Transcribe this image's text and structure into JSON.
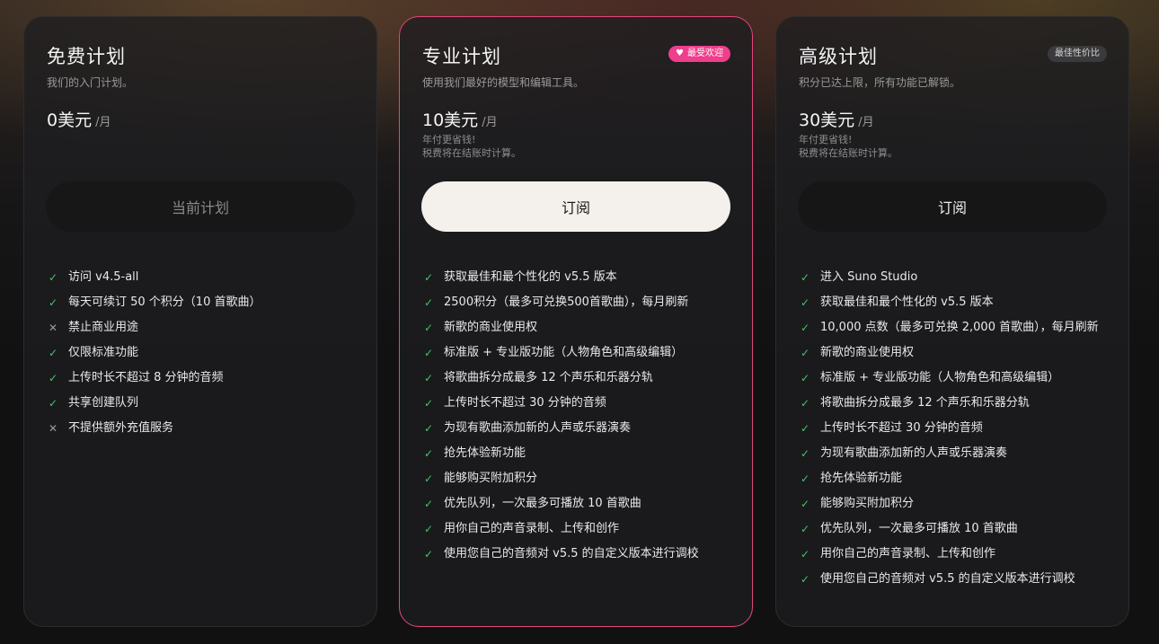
{
  "plans": {
    "free": {
      "name": "免费计划",
      "desc": "我们的入门计划。",
      "price": "0美元",
      "unit": "/月",
      "cta": "当前计划",
      "features": [
        {
          "icon": "check",
          "text": "访问 v4.5-all"
        },
        {
          "icon": "check",
          "text": "每天可续订 50 个积分（10 首歌曲）"
        },
        {
          "icon": "cross",
          "text": "禁止商业用途"
        },
        {
          "icon": "check",
          "text": "仅限标准功能"
        },
        {
          "icon": "check",
          "text": "上传时长不超过 8 分钟的音频"
        },
        {
          "icon": "check",
          "text": "共享创建队列"
        },
        {
          "icon": "cross",
          "text": "不提供额外充值服务"
        }
      ]
    },
    "pro": {
      "name": "专业计划",
      "badge": "最受欢迎",
      "desc": "使用我们最好的模型和编辑工具。",
      "price": "10美元",
      "unit": "/月",
      "note1": "年付更省钱!",
      "note2": "税费将在结账时计算。",
      "cta": "订阅",
      "features": [
        {
          "icon": "check",
          "text": "获取最佳和最个性化的 v5.5 版本"
        },
        {
          "icon": "check",
          "text": "2500积分（最多可兑换500首歌曲），每月刷新"
        },
        {
          "icon": "check",
          "text": "新歌的商业使用权"
        },
        {
          "icon": "check",
          "text": "标准版 + 专业版功能（人物角色和高级编辑）"
        },
        {
          "icon": "check",
          "text": "将歌曲拆分成最多 12 个声乐和乐器分轨"
        },
        {
          "icon": "check",
          "text": "上传时长不超过 30 分钟的音频"
        },
        {
          "icon": "check",
          "text": "为现有歌曲添加新的人声或乐器演奏"
        },
        {
          "icon": "check",
          "text": "抢先体验新功能"
        },
        {
          "icon": "check",
          "text": "能够购买附加积分"
        },
        {
          "icon": "check",
          "text": "优先队列，一次最多可播放 10 首歌曲"
        },
        {
          "icon": "check",
          "text": "用你自己的声音录制、上传和创作"
        },
        {
          "icon": "check",
          "text": "使用您自己的音频对 v5.5 的自定义版本进行调校"
        }
      ]
    },
    "premier": {
      "name": "高级计划",
      "badge": "最佳性价比",
      "desc": "积分已达上限，所有功能已解锁。",
      "price": "30美元",
      "unit": "/月",
      "note1": "年付更省钱!",
      "note2": "税费将在结账时计算。",
      "cta": "订阅",
      "features": [
        {
          "icon": "check",
          "text": "进入 Suno Studio"
        },
        {
          "icon": "check",
          "text": "获取最佳和最个性化的 v5.5 版本"
        },
        {
          "icon": "check",
          "text": "10,000 点数（最多可兑换 2,000 首歌曲），每月刷新"
        },
        {
          "icon": "check",
          "text": "新歌的商业使用权"
        },
        {
          "icon": "check",
          "text": "标准版 + 专业版功能（人物角色和高级编辑）"
        },
        {
          "icon": "check",
          "text": "将歌曲拆分成最多 12 个声乐和乐器分轨"
        },
        {
          "icon": "check",
          "text": "上传时长不超过 30 分钟的音频"
        },
        {
          "icon": "check",
          "text": "为现有歌曲添加新的人声或乐器演奏"
        },
        {
          "icon": "check",
          "text": "抢先体验新功能"
        },
        {
          "icon": "check",
          "text": "能够购买附加积分"
        },
        {
          "icon": "check",
          "text": "优先队列，一次最多可播放 10 首歌曲"
        },
        {
          "icon": "check",
          "text": "用你自己的声音录制、上传和创作"
        },
        {
          "icon": "check",
          "text": "使用您自己的音频对 v5.5 的自定义版本进行调校"
        }
      ]
    }
  },
  "colors": {
    "accent": "#e2457d",
    "badge_pink": "#ef3e8c",
    "check": "#42c46b"
  },
  "icons": {
    "check": "✓",
    "cross": "✕",
    "heart": "♥"
  }
}
